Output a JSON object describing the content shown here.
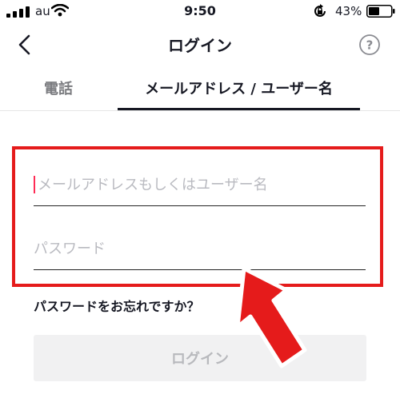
{
  "status_bar": {
    "carrier": "au",
    "time": "9:50",
    "battery": "43%",
    "icons": [
      "signal-icon",
      "wifi-icon",
      "rotation-lock-icon",
      "battery-icon"
    ]
  },
  "header": {
    "title": "ログイン",
    "icons": [
      "back-chevron-icon",
      "help-icon"
    ]
  },
  "tabs": [
    {
      "label": "電話",
      "selected": false
    },
    {
      "label": "メールアドレス / ユーザー名",
      "selected": true
    }
  ],
  "form": {
    "email_placeholder": "メールアドレスもしくはユーザー名",
    "password_placeholder": "パスワード",
    "forgot_password": "パスワードをお忘れですか？",
    "login_button": "ログイン"
  },
  "colors": {
    "annotation": "#e51b1b",
    "caret": "#fe2c55",
    "button_bg": "#f1f1f2",
    "button_text": "#b8b9bd"
  }
}
